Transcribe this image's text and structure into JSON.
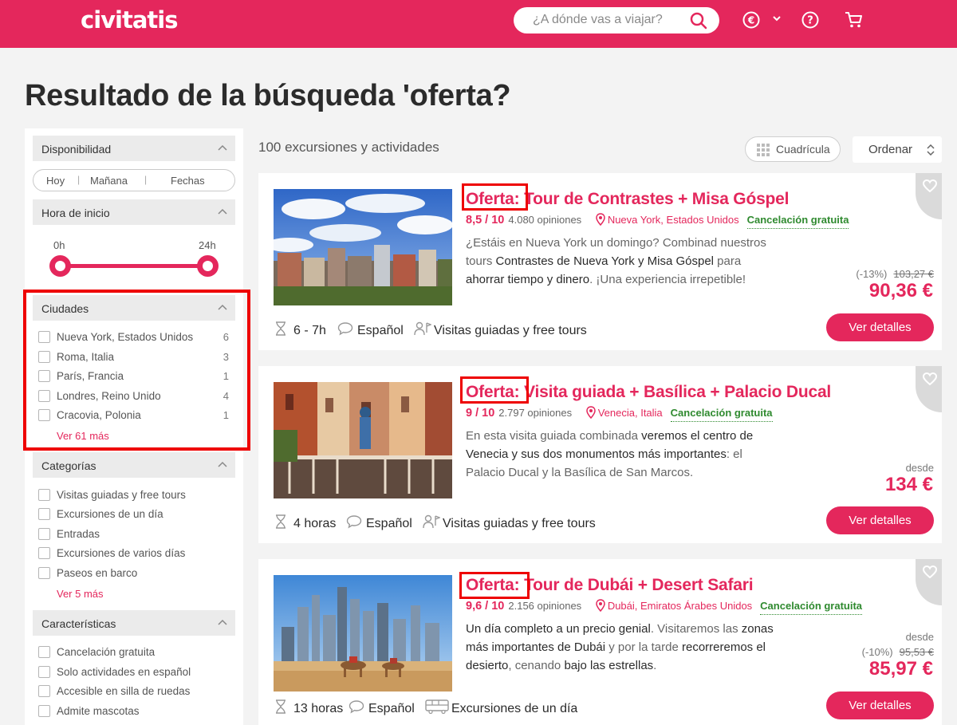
{
  "header": {
    "logo": "civitatis",
    "search_placeholder": "¿A dónde vas a viajar?",
    "icons": [
      "search-icon",
      "euro-icon",
      "chevron-down-icon",
      "help-icon",
      "cart-icon"
    ]
  },
  "page_title": "Resultado de la búsqueda 'oferta?",
  "sidebar": {
    "availability": {
      "title": "Disponibilidad",
      "options": [
        "Hoy",
        "Mañana",
        "Fechas"
      ]
    },
    "start_time": {
      "title": "Hora de inicio",
      "min_label": "0h",
      "max_label": "24h",
      "range": [
        0,
        24
      ]
    },
    "cities": {
      "title": "Ciudades",
      "items": [
        {
          "label": "Nueva York, Estados Unidos",
          "count": "6"
        },
        {
          "label": "Roma, Italia",
          "count": "3"
        },
        {
          "label": "París, Francia",
          "count": "1"
        },
        {
          "label": "Londres, Reino Unido",
          "count": "4"
        },
        {
          "label": "Cracovia, Polonia",
          "count": "1"
        }
      ],
      "more": "Ver 61 más"
    },
    "categories": {
      "title": "Categorías",
      "items": [
        {
          "label": "Visitas guiadas y free tours"
        },
        {
          "label": "Excursiones de un día"
        },
        {
          "label": "Entradas"
        },
        {
          "label": "Excursiones de varios días"
        },
        {
          "label": "Paseos en barco"
        }
      ],
      "more": "Ver 5 más"
    },
    "features": {
      "title": "Características",
      "items": [
        {
          "label": "Cancelación gratuita"
        },
        {
          "label": "Solo actividades en español"
        },
        {
          "label": "Accesible en silla de ruedas"
        },
        {
          "label": "Admite mascotas"
        }
      ]
    }
  },
  "results": {
    "count_label": "100 excursiones y actividades",
    "grid_label": "Cuadrícula",
    "sort_label": "Ordenar",
    "cards": [
      {
        "offer": "Oferta:",
        "title": " Tour de Contrastes + Misa Góspel",
        "score": "8,5 / 10",
        "reviews": "4.080 opiniones",
        "location": "Nueva York, Estados Unidos",
        "cancel": "Cancelación gratuita",
        "desc_html": "¿Estáis en Nueva York un domingo? Combinad nuestros tours <b>Contrastes de Nueva York y Misa Góspel</b> para <b>ahorrar tiempo y dinero</b>. ¡Una experiencia irrepetible!",
        "discount": "(-13%)",
        "old_price": "103,27 €",
        "from_label": "",
        "price": "90,36 €",
        "duration": "6 - 7h",
        "language": "Español",
        "category": "Visitas guiadas y free tours",
        "category_icon": "guide-icon",
        "button": "Ver detalles"
      },
      {
        "offer": "Oferta:",
        "title": " Visita guiada + Basílica + Palacio Ducal",
        "score": "9 / 10",
        "reviews": "2.797 opiniones",
        "location": "Venecia, Italia",
        "cancel": "Cancelación gratuita",
        "desc_html": "En esta visita guiada combinada <b>veremos el centro de Venecia y sus dos monumentos más importantes</b>: el Palacio Ducal y la Basílica de San Marcos.",
        "discount": "",
        "old_price": "",
        "from_label": "desde",
        "price": "134 €",
        "duration": "4 horas",
        "language": "Español",
        "category": "Visitas guiadas y free tours",
        "category_icon": "guide-icon",
        "button": "Ver detalles"
      },
      {
        "offer": "Oferta:",
        "title": " Tour de Dubái + Desert Safari",
        "score": "9,6 / 10",
        "reviews": "2.156 opiniones",
        "location": "Dubái, Emiratos Árabes Unidos",
        "cancel": "Cancelación gratuita",
        "desc_html": "<b>Un día completo a un precio genial</b>. Visitaremos las <b>zonas más importantes de Dubái</b> y por la tarde <b>recorreremos el desierto</b>, cenando <b>bajo las estrellas</b>.",
        "discount": "(-10%)",
        "old_price": "95,53 €",
        "from_label": "desde",
        "price": "85,97 €",
        "duration": "13 horas",
        "language": "Español",
        "category": "Excursiones de un día",
        "category_icon": "bus-icon",
        "button": "Ver detalles"
      }
    ]
  },
  "colors": {
    "brand": "#e4275c",
    "green": "#2f8a2f",
    "highlight": "#ee0000"
  }
}
